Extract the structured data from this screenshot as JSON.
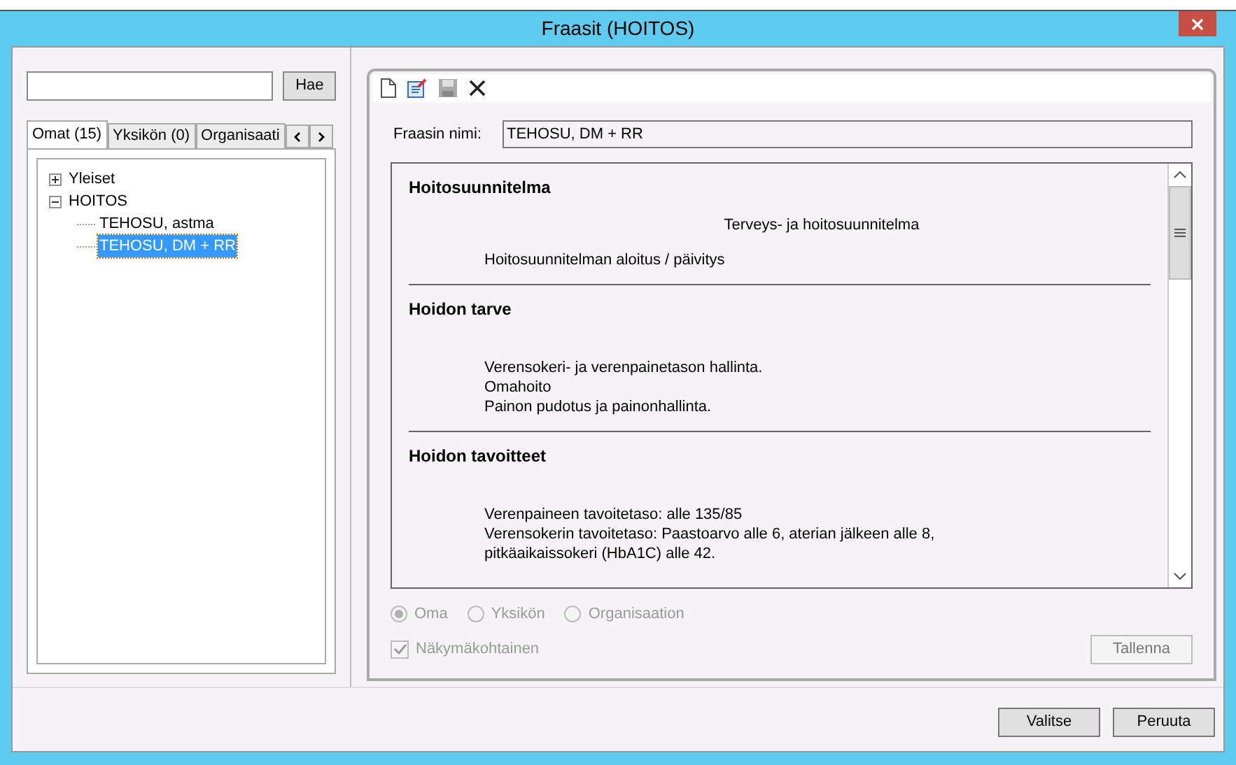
{
  "window": {
    "title": "Fraasit (HOITOS)"
  },
  "search": {
    "button": "Hae"
  },
  "tabs": [
    {
      "label": "Omat (15)",
      "selected": true
    },
    {
      "label": "Yksikön (0)",
      "selected": false
    },
    {
      "label": "Organisaati",
      "selected": false
    }
  ],
  "tree": [
    {
      "label": "Yleiset",
      "expanded": false,
      "selected": false
    },
    {
      "label": "HOITOS",
      "expanded": true,
      "selected": false,
      "children": [
        {
          "label": "TEHOSU, astma",
          "selected": false
        },
        {
          "label": "TEHOSU, DM + RR",
          "selected": true
        }
      ]
    }
  ],
  "name_field": {
    "label": "Fraasin nimi:",
    "value": "TEHOSU, DM + RR"
  },
  "sections": [
    {
      "heading": "Hoitosuunnitelma",
      "lines": [
        {
          "kind": "center",
          "text": "Terveys- ja hoitosuunnitelma"
        },
        {
          "kind": "indent",
          "text": "Hoitosuunnitelman aloitus / päivitys"
        }
      ]
    },
    {
      "heading": "Hoidon tarve",
      "lines": [
        {
          "kind": "gap"
        },
        {
          "kind": "indent",
          "text": "Verensokeri- ja verenpainetason hallinta."
        },
        {
          "kind": "indent",
          "text": "Omahoito"
        },
        {
          "kind": "indent",
          "text": "Painon pudotus ja painonhallinta."
        }
      ]
    },
    {
      "heading": "Hoidon tavoitteet",
      "lines": [
        {
          "kind": "gap"
        },
        {
          "kind": "indent",
          "text": "Verenpaineen tavoitetaso: alle 135/85"
        },
        {
          "kind": "indent",
          "text": "Verensokerin tavoitetaso: Paastoarvo alle 6, aterian jälkeen alle 8, pitkäaikaissokeri (HbA1C) alle 42."
        }
      ]
    }
  ],
  "radios": [
    {
      "label": "Oma",
      "selected": true
    },
    {
      "label": "Yksikön",
      "selected": false
    },
    {
      "label": "Organisaation",
      "selected": false
    }
  ],
  "view_checkbox": {
    "label": "Näkymäkohtainen",
    "checked": true
  },
  "save_button": "Tallenna",
  "footer_buttons": [
    "Valitse",
    "Peruuta"
  ]
}
